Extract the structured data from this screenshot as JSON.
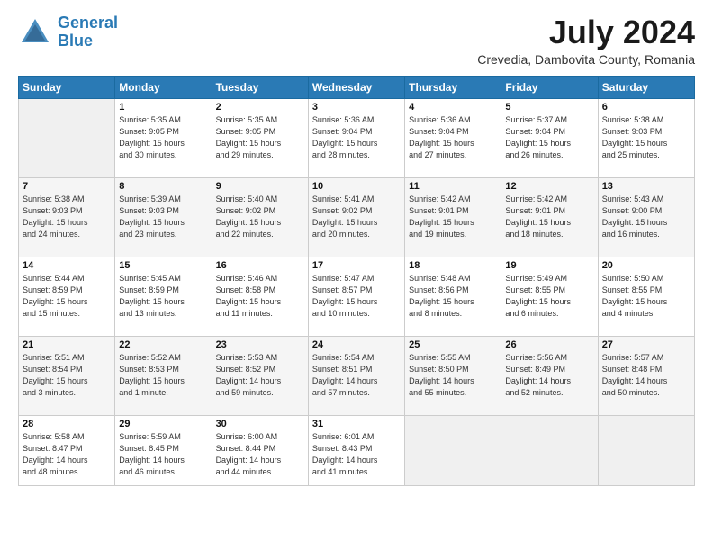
{
  "header": {
    "logo_line1": "General",
    "logo_line2": "Blue",
    "month_year": "July 2024",
    "location": "Crevedia, Dambovita County, Romania"
  },
  "days_of_week": [
    "Sunday",
    "Monday",
    "Tuesday",
    "Wednesday",
    "Thursday",
    "Friday",
    "Saturday"
  ],
  "weeks": [
    [
      {
        "day": "",
        "info": ""
      },
      {
        "day": "1",
        "info": "Sunrise: 5:35 AM\nSunset: 9:05 PM\nDaylight: 15 hours\nand 30 minutes."
      },
      {
        "day": "2",
        "info": "Sunrise: 5:35 AM\nSunset: 9:05 PM\nDaylight: 15 hours\nand 29 minutes."
      },
      {
        "day": "3",
        "info": "Sunrise: 5:36 AM\nSunset: 9:04 PM\nDaylight: 15 hours\nand 28 minutes."
      },
      {
        "day": "4",
        "info": "Sunrise: 5:36 AM\nSunset: 9:04 PM\nDaylight: 15 hours\nand 27 minutes."
      },
      {
        "day": "5",
        "info": "Sunrise: 5:37 AM\nSunset: 9:04 PM\nDaylight: 15 hours\nand 26 minutes."
      },
      {
        "day": "6",
        "info": "Sunrise: 5:38 AM\nSunset: 9:03 PM\nDaylight: 15 hours\nand 25 minutes."
      }
    ],
    [
      {
        "day": "7",
        "info": "Sunrise: 5:38 AM\nSunset: 9:03 PM\nDaylight: 15 hours\nand 24 minutes."
      },
      {
        "day": "8",
        "info": "Sunrise: 5:39 AM\nSunset: 9:03 PM\nDaylight: 15 hours\nand 23 minutes."
      },
      {
        "day": "9",
        "info": "Sunrise: 5:40 AM\nSunset: 9:02 PM\nDaylight: 15 hours\nand 22 minutes."
      },
      {
        "day": "10",
        "info": "Sunrise: 5:41 AM\nSunset: 9:02 PM\nDaylight: 15 hours\nand 20 minutes."
      },
      {
        "day": "11",
        "info": "Sunrise: 5:42 AM\nSunset: 9:01 PM\nDaylight: 15 hours\nand 19 minutes."
      },
      {
        "day": "12",
        "info": "Sunrise: 5:42 AM\nSunset: 9:01 PM\nDaylight: 15 hours\nand 18 minutes."
      },
      {
        "day": "13",
        "info": "Sunrise: 5:43 AM\nSunset: 9:00 PM\nDaylight: 15 hours\nand 16 minutes."
      }
    ],
    [
      {
        "day": "14",
        "info": "Sunrise: 5:44 AM\nSunset: 8:59 PM\nDaylight: 15 hours\nand 15 minutes."
      },
      {
        "day": "15",
        "info": "Sunrise: 5:45 AM\nSunset: 8:59 PM\nDaylight: 15 hours\nand 13 minutes."
      },
      {
        "day": "16",
        "info": "Sunrise: 5:46 AM\nSunset: 8:58 PM\nDaylight: 15 hours\nand 11 minutes."
      },
      {
        "day": "17",
        "info": "Sunrise: 5:47 AM\nSunset: 8:57 PM\nDaylight: 15 hours\nand 10 minutes."
      },
      {
        "day": "18",
        "info": "Sunrise: 5:48 AM\nSunset: 8:56 PM\nDaylight: 15 hours\nand 8 minutes."
      },
      {
        "day": "19",
        "info": "Sunrise: 5:49 AM\nSunset: 8:55 PM\nDaylight: 15 hours\nand 6 minutes."
      },
      {
        "day": "20",
        "info": "Sunrise: 5:50 AM\nSunset: 8:55 PM\nDaylight: 15 hours\nand 4 minutes."
      }
    ],
    [
      {
        "day": "21",
        "info": "Sunrise: 5:51 AM\nSunset: 8:54 PM\nDaylight: 15 hours\nand 3 minutes."
      },
      {
        "day": "22",
        "info": "Sunrise: 5:52 AM\nSunset: 8:53 PM\nDaylight: 15 hours\nand 1 minute."
      },
      {
        "day": "23",
        "info": "Sunrise: 5:53 AM\nSunset: 8:52 PM\nDaylight: 14 hours\nand 59 minutes."
      },
      {
        "day": "24",
        "info": "Sunrise: 5:54 AM\nSunset: 8:51 PM\nDaylight: 14 hours\nand 57 minutes."
      },
      {
        "day": "25",
        "info": "Sunrise: 5:55 AM\nSunset: 8:50 PM\nDaylight: 14 hours\nand 55 minutes."
      },
      {
        "day": "26",
        "info": "Sunrise: 5:56 AM\nSunset: 8:49 PM\nDaylight: 14 hours\nand 52 minutes."
      },
      {
        "day": "27",
        "info": "Sunrise: 5:57 AM\nSunset: 8:48 PM\nDaylight: 14 hours\nand 50 minutes."
      }
    ],
    [
      {
        "day": "28",
        "info": "Sunrise: 5:58 AM\nSunset: 8:47 PM\nDaylight: 14 hours\nand 48 minutes."
      },
      {
        "day": "29",
        "info": "Sunrise: 5:59 AM\nSunset: 8:45 PM\nDaylight: 14 hours\nand 46 minutes."
      },
      {
        "day": "30",
        "info": "Sunrise: 6:00 AM\nSunset: 8:44 PM\nDaylight: 14 hours\nand 44 minutes."
      },
      {
        "day": "31",
        "info": "Sunrise: 6:01 AM\nSunset: 8:43 PM\nDaylight: 14 hours\nand 41 minutes."
      },
      {
        "day": "",
        "info": ""
      },
      {
        "day": "",
        "info": ""
      },
      {
        "day": "",
        "info": ""
      }
    ]
  ]
}
